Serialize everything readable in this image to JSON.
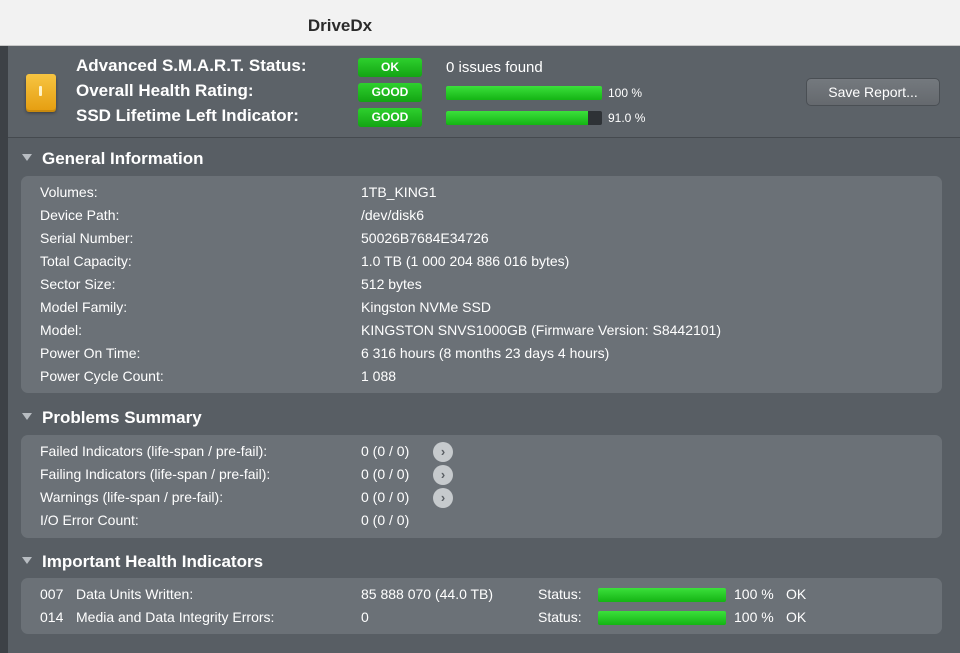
{
  "window": {
    "title": "DriveDx"
  },
  "status": {
    "rows": [
      {
        "label": "Advanced S.M.A.R.T. Status:",
        "badge": "OK",
        "text": "0 issues found"
      },
      {
        "label": "Overall Health Rating:",
        "badge": "GOOD",
        "percent": "100 %",
        "level": 1.0
      },
      {
        "label": "SSD Lifetime Left Indicator:",
        "badge": "GOOD",
        "percent": "91.0 %",
        "level": 0.91
      }
    ],
    "save_button": "Save Report..."
  },
  "general": {
    "title": "General Information",
    "rows": [
      {
        "key": "Volumes:",
        "value": "1TB_KING1"
      },
      {
        "key": "Device Path:",
        "value": "/dev/disk6"
      },
      {
        "key": "Serial Number:",
        "value": "50026B7684E34726"
      },
      {
        "key": "Total Capacity:",
        "value": "1.0 TB (1 000 204 886 016 bytes)"
      },
      {
        "key": "Sector Size:",
        "value": "512 bytes"
      },
      {
        "key": "Model Family:",
        "value": "Kingston NVMe SSD"
      },
      {
        "key": "Model:",
        "value": "KINGSTON SNVS1000GB  (Firmware Version: S8442101)"
      },
      {
        "key": "Power On Time:",
        "value": "6 316 hours (8 months 23 days 4 hours)"
      },
      {
        "key": "Power Cycle Count:",
        "value": "1 088"
      }
    ]
  },
  "problems": {
    "title": "Problems Summary",
    "rows": [
      {
        "key": "Failed Indicators (life-span / pre-fail):",
        "value": "0 (0 / 0)"
      },
      {
        "key": "Failing Indicators (life-span / pre-fail):",
        "value": "0 (0 / 0)"
      },
      {
        "key": "Warnings (life-span / pre-fail):",
        "value": "0 (0 / 0)"
      },
      {
        "key": "I/O Error Count:",
        "value": "0 (0 / 0)"
      }
    ],
    "arrow_glyph": "›"
  },
  "health": {
    "title": "Important Health Indicators",
    "rows": [
      {
        "id": "007",
        "name": "Data Units Written:",
        "value": "85 888 070 (44.0 TB)",
        "status_label": "Status:",
        "percent": "100 %",
        "level": 1.0,
        "state": "OK"
      },
      {
        "id": "014",
        "name": "Media and Data Integrity Errors:",
        "value": "0",
        "status_label": "Status:",
        "percent": "100 %",
        "level": 1.0,
        "state": "OK"
      }
    ]
  }
}
